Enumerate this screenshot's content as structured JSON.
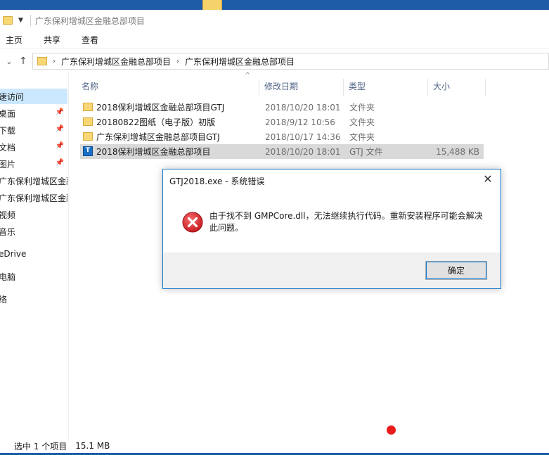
{
  "window": {
    "title": "广东保利增城区金融总部项目"
  },
  "ribbon": {
    "tabs": [
      "主页",
      "共享",
      "查看"
    ]
  },
  "address": {
    "crumbs": [
      "广东保利增城区金融总部项目",
      "广东保利增城区金融总部项目"
    ]
  },
  "nav": {
    "items": [
      {
        "label": "速访问",
        "pinned": false,
        "selected": true
      },
      {
        "label": "桌面",
        "pinned": true
      },
      {
        "label": "下载",
        "pinned": true
      },
      {
        "label": "文档",
        "pinned": true
      },
      {
        "label": "图片",
        "pinned": true
      },
      {
        "label": "广东保利增城区金融",
        "pinned": false
      },
      {
        "label": "广东保利增城区金融",
        "pinned": false
      },
      {
        "label": "视频",
        "pinned": false
      },
      {
        "label": "音乐",
        "pinned": false
      },
      {
        "label": "eDrive",
        "pinned": false
      },
      {
        "label": "电脑",
        "pinned": false
      },
      {
        "label": "络",
        "pinned": false
      }
    ]
  },
  "columns": {
    "name": "名称",
    "date": "修改日期",
    "type": "类型",
    "size": "大小"
  },
  "files": [
    {
      "name": "2018保利增城区金融总部项目GTJ",
      "date": "2018/10/20 18:01",
      "type": "文件夹",
      "size": "",
      "icon": "folder-icon"
    },
    {
      "name": "20180822图纸（电子版）初版",
      "date": "2018/9/12 10:56",
      "type": "文件夹",
      "size": "",
      "icon": "folder-icon"
    },
    {
      "name": "广东保利增城区金融总部项目GTJ",
      "date": "2018/10/17 14:36",
      "type": "文件夹",
      "size": "",
      "icon": "folder-icon"
    },
    {
      "name": "2018保利增城区金融总部项目",
      "date": "2018/10/20 18:01",
      "type": "GTJ 文件",
      "size": "15,488 KB",
      "icon": "gtj-file-icon",
      "selected": true
    }
  ],
  "status": {
    "selection": "选中 1 个项目",
    "size": "15.1 MB"
  },
  "dialog": {
    "title": "GTJ2018.exe - 系统错误",
    "message": "由于找不到 GMPCore.dll，无法继续执行代码。重新安装程序可能会解决此问题。",
    "ok_label": "确定",
    "icon": "error-icon"
  }
}
